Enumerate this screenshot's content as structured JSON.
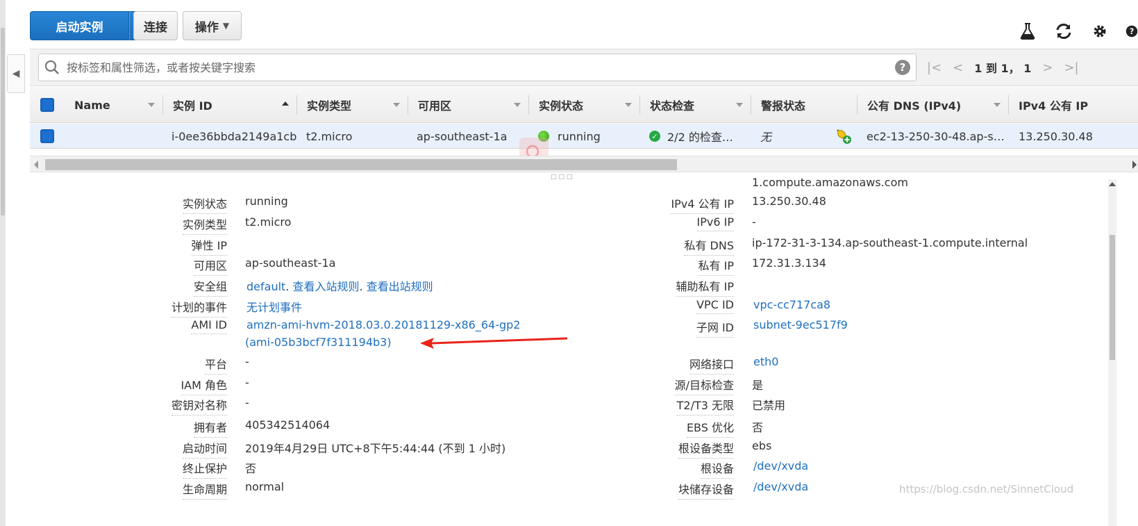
{
  "toolbar": {
    "launch_label": "启动实例",
    "connect_label": "连接",
    "actions_label": "操作",
    "icons": [
      "flask-icon",
      "refresh-icon",
      "gear-icon",
      "help-icon"
    ]
  },
  "search": {
    "placeholder": "按标签和属性筛选，或者按关键字搜索",
    "value": "",
    "help_glyph": "?"
  },
  "pager": {
    "info": "1 到 1， 1"
  },
  "table": {
    "columns": [
      "Name",
      "实例 ID",
      "实例类型",
      "可用区",
      "实例状态",
      "状态检查",
      "警报状态",
      "公有 DNS (IPv4)",
      "IPv4 公有 IP"
    ],
    "row": {
      "name": "",
      "instance_id": "i-0ee36bbda2149a1cb",
      "instance_type": "t2.micro",
      "az": "ap-southeast-1a",
      "state": "running",
      "status_check": "2/2 的检查…",
      "alarm": "无",
      "public_dns": "ec2-13-250-30-48.ap-s…",
      "public_ip": "13.250.30.48"
    }
  },
  "details": {
    "left": [
      {
        "label": "实例状态",
        "value": "running"
      },
      {
        "label": "实例类型",
        "value": "t2.micro"
      },
      {
        "label": "弹性 IP",
        "value": ""
      },
      {
        "label": "可用区",
        "value": "ap-southeast-1a"
      },
      {
        "label": "安全组",
        "link1": "default",
        "sep1": ". ",
        "link2": "查看入站规则",
        "sep2": ". ",
        "link3": "查看出站规则"
      },
      {
        "label": "计划的事件",
        "value": "无计划事件"
      },
      {
        "label": "AMI ID",
        "value": "amzn-ami-hvm-2018.03.0.20181129-x86_64-gp2",
        "value2": "(ami-05b3bcf7f311194b3)"
      },
      {
        "label": "平台",
        "value": "-"
      },
      {
        "label": "IAM 角色",
        "value": "-"
      },
      {
        "label": "密钥对名称",
        "value": "-"
      },
      {
        "label": "拥有者",
        "value": "405342514064"
      },
      {
        "label": "启动时间",
        "value": "2019年4月29日 UTC+8下午5:44:44 (不到 1 小时)"
      },
      {
        "label": "终止保护",
        "value": "否"
      },
      {
        "label": "生命周期",
        "value": "normal"
      }
    ],
    "right_top_overflow": "1.compute.amazonaws.com",
    "right": [
      {
        "label": "IPv4 公有 IP",
        "value": "13.250.30.48"
      },
      {
        "label": "IPv6 IP",
        "value": "-"
      },
      {
        "label": "私有 DNS",
        "value": "ip-172-31-3-134.ap-southeast-1.compute.internal"
      },
      {
        "label": "私有 IP",
        "value": "172.31.3.134"
      },
      {
        "label": "辅助私有 IP",
        "value": ""
      },
      {
        "label": "VPC ID",
        "value": "vpc-cc717ca8"
      },
      {
        "label": "子网 ID",
        "value": "subnet-9ec517f9"
      },
      {
        "label": "网络接口",
        "value": "eth0"
      },
      {
        "label": "源/目标检查",
        "value": "是"
      },
      {
        "label": "T2/T3 无限",
        "value": "已禁用"
      },
      {
        "label": "EBS 优化",
        "value": "否"
      },
      {
        "label": "根设备类型",
        "value": "ebs"
      },
      {
        "label": "根设备",
        "value": "/dev/xvda"
      },
      {
        "label": "块储存设备",
        "value": "/dev/xvda"
      }
    ]
  },
  "watermark": "https://blog.csdn.net/SinnetCloud",
  "colors": {
    "primary": "#1a6fbd",
    "link": "#1f6fbf",
    "annotation_arrow": "#e8231a",
    "running": "#2c9a10"
  }
}
